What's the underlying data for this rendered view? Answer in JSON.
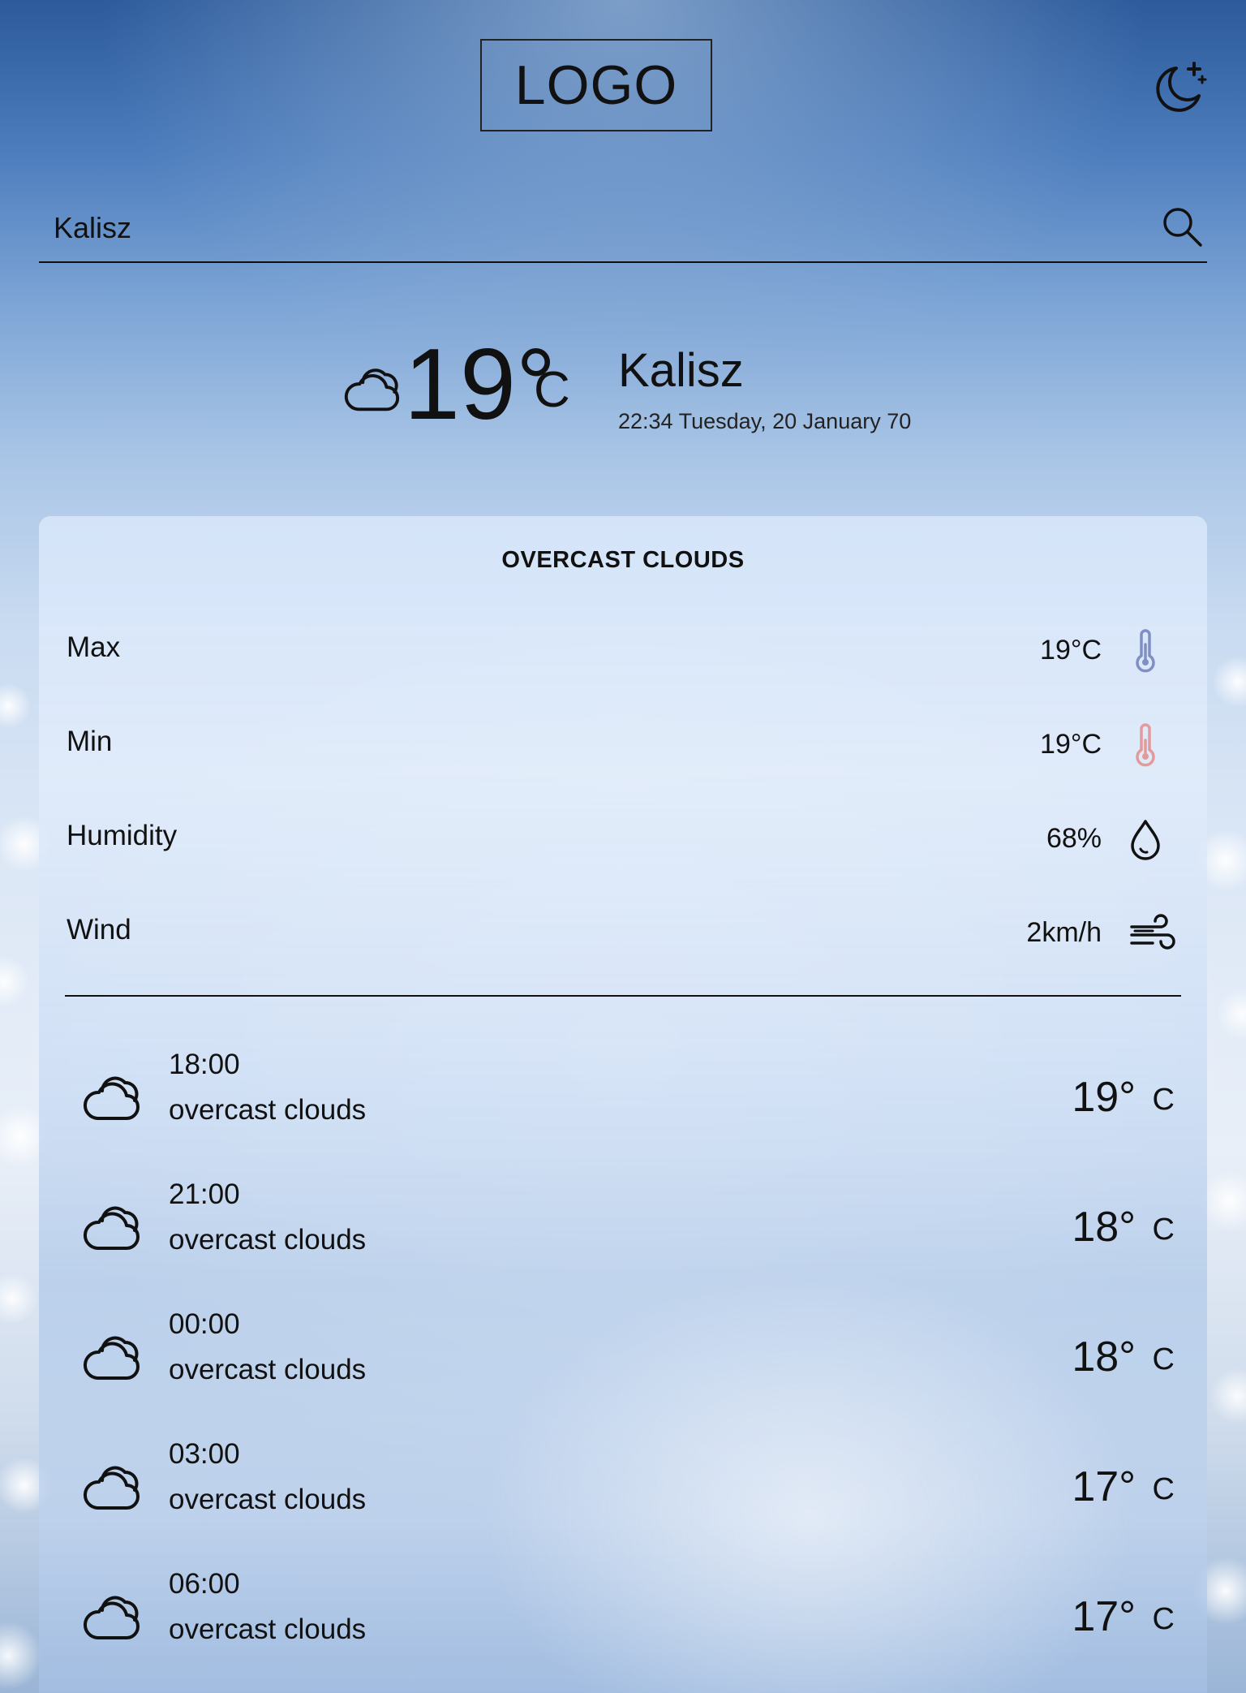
{
  "header": {
    "logo_text": "LOGO",
    "theme_toggle_icon": "moon-star-icon"
  },
  "search": {
    "value": "Kalisz",
    "placeholder": "",
    "icon": "search-icon"
  },
  "current": {
    "icon": "cloud-icon",
    "temperature": "19°",
    "unit": "C",
    "city": "Kalisz",
    "datetime": "22:34 Tuesday, 20 January 70"
  },
  "details": {
    "condition": "OVERCAST CLOUDS",
    "rows": [
      {
        "label": "Max",
        "value": "19°C",
        "icon": "thermometer-icon",
        "icon_color": "#7f8fc4"
      },
      {
        "label": "Min",
        "value": "19°C",
        "icon": "thermometer-icon",
        "icon_color": "#e39a9a"
      },
      {
        "label": "Humidity",
        "value": "68%",
        "icon": "droplet-icon",
        "icon_color": "#111111"
      },
      {
        "label": "Wind",
        "value": "2km/h",
        "icon": "wind-icon",
        "icon_color": "#111111"
      }
    ]
  },
  "forecast": [
    {
      "time": "18:00",
      "description": "overcast clouds",
      "temp": "19°",
      "unit": "C",
      "icon": "cloud-icon"
    },
    {
      "time": "21:00",
      "description": "overcast clouds",
      "temp": "18°",
      "unit": "C",
      "icon": "cloud-icon"
    },
    {
      "time": "00:00",
      "description": "overcast clouds",
      "temp": "18°",
      "unit": "C",
      "icon": "cloud-icon"
    },
    {
      "time": "03:00",
      "description": "overcast clouds",
      "temp": "17°",
      "unit": "C",
      "icon": "cloud-icon"
    },
    {
      "time": "06:00",
      "description": "overcast clouds",
      "temp": "17°",
      "unit": "C",
      "icon": "cloud-icon"
    }
  ]
}
